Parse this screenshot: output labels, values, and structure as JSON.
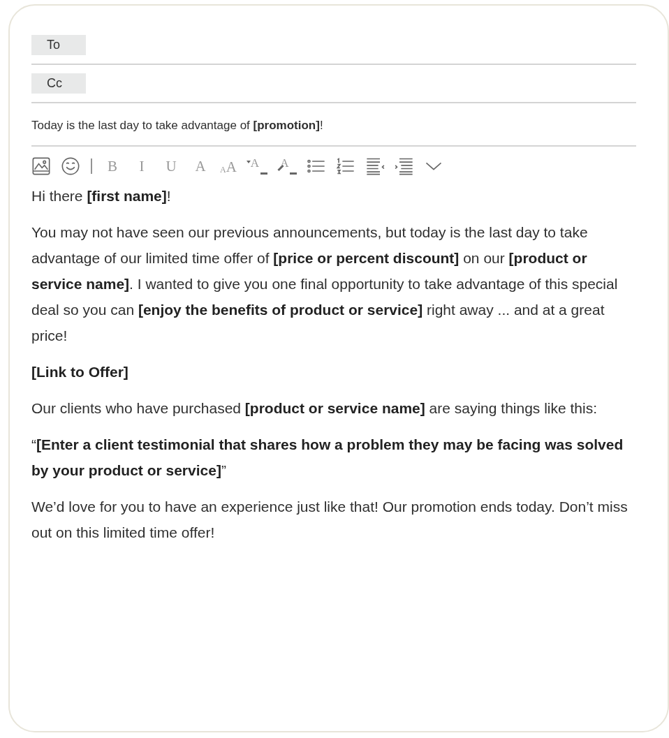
{
  "recipients": [
    {
      "label": "To"
    },
    {
      "label": "Cc"
    }
  ],
  "subject": "Today is the last day to take advantage of **[promotion]**!",
  "toolbar": [
    {
      "kind": "image"
    },
    {
      "kind": "emoji"
    },
    {
      "kind": "separator"
    },
    {
      "kind": "text",
      "label": "B"
    },
    {
      "kind": "text",
      "label": "I"
    },
    {
      "kind": "text",
      "label": "U"
    },
    {
      "kind": "text",
      "label": "A"
    },
    {
      "kind": "font-size",
      "label": "A",
      "label_2": "A"
    },
    {
      "kind": "font-color",
      "label": "A"
    },
    {
      "kind": "highlight",
      "label": "A"
    },
    {
      "kind": "bullets"
    },
    {
      "kind": "numbers"
    },
    {
      "kind": "outdent"
    },
    {
      "kind": "indent"
    },
    {
      "kind": "more"
    }
  ],
  "body": [
    "Hi there **[first name]**!",
    "You may not have seen our previous announcements, but today is the last day to take advantage of our limited time offer of **[price or percent discount]** on our **[product or service name]**. I wanted to give you one final opportunity to take advantage of this special deal so you can **[enjoy the benefits of product or service]** right away ... and at a great price!",
    "**[Link to Offer]**",
    "Our clients who have purchased **[product or service name]** are saying things like this:",
    "“**[Enter a client testimonial that shares how a problem they may be facing was solved by your product or service]**”",
    "We’d love for you to have an experience just like that! Our promotion ends today. Don’t miss out on this limited time offer!"
  ]
}
